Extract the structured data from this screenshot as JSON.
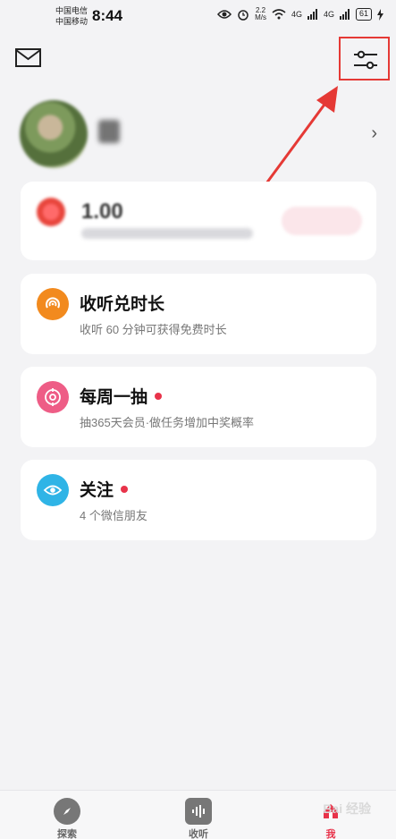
{
  "status_bar": {
    "carrier_1": "中国电信",
    "carrier_2": "中国移动",
    "time": "8:44",
    "net_speed_value": "2.2",
    "net_speed_unit": "M/s",
    "signal_1": "4G",
    "signal_2": "4G",
    "battery": "61"
  },
  "header": {
    "mail_icon": "mail-icon",
    "settings_icon": "sliders-icon"
  },
  "profile": {
    "avatar_icon": "avatar-image",
    "username": "",
    "chevron_icon": "chevron-right-icon",
    "chevron": "›"
  },
  "vip_card": {
    "amount": "1.00",
    "unit": "",
    "desc": "",
    "button_label": ""
  },
  "features": [
    {
      "title": "收听兑时长",
      "desc": "收听 60 分钟可获得免费时长",
      "icon": "headphones-waves-icon",
      "icon_color": "#f28a1e",
      "has_dot": false
    },
    {
      "title": "每周一抽",
      "desc": "抽365天会员·做任务增加中奖概率",
      "icon": "target-icon",
      "icon_color": "#ee5d86",
      "has_dot": true
    },
    {
      "title": "关注",
      "desc": "4 个微信朋友",
      "icon": "eye-icon",
      "icon_color": "#2fb4e6",
      "has_dot": true
    }
  ],
  "bottom_nav": [
    {
      "label": "探索",
      "icon": "compass-icon"
    },
    {
      "label": "收听",
      "icon": "audio-wave-icon"
    },
    {
      "label": "我",
      "icon": "home-icon"
    }
  ],
  "colors": {
    "accent_red": "#e8334a",
    "highlight_box": "#e53935",
    "background": "#f3f3f5"
  },
  "watermark": "Bai 经验"
}
